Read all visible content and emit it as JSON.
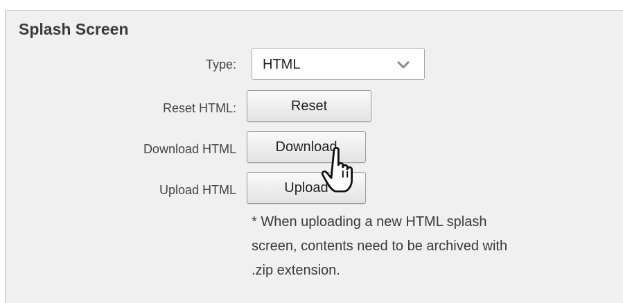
{
  "section": {
    "title": "Splash Screen"
  },
  "type_row": {
    "label": "Type:",
    "selected": "HTML",
    "icon": "chevron-down-icon"
  },
  "reset_row": {
    "label": "Reset HTML:",
    "button": "Reset"
  },
  "download_row": {
    "label": "Download HTML",
    "button": "Download"
  },
  "upload_row": {
    "label": "Upload HTML",
    "button": "Upload"
  },
  "note": {
    "line1": "* When uploading a new HTML splash",
    "line2": "screen, contents need to be archived with",
    "line3": ".zip extension."
  },
  "cursor": {
    "icon": "hand-pointer-icon"
  },
  "colors": {
    "panel_background": "#f0f0f0",
    "text": "#3a3a3a",
    "button_border": "#9c9c9c"
  }
}
